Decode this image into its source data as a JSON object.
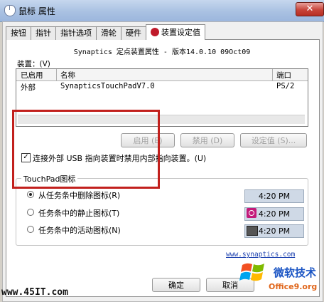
{
  "window": {
    "title": "鼠标 属性",
    "close_glyph": "✕"
  },
  "tabs": [
    {
      "label": "按钮",
      "active": false
    },
    {
      "label": "指针",
      "active": false
    },
    {
      "label": "指针选项",
      "active": false
    },
    {
      "label": "滑轮",
      "active": false
    },
    {
      "label": "硬件",
      "active": false
    },
    {
      "label": "装置设定值",
      "active": true,
      "icon": "synaptics-icon"
    }
  ],
  "panel": {
    "heading": "Synaptics 定点装置属性 - 版本14.0.10 09Oct09",
    "devices_label": "装置：(V)",
    "columns": {
      "enabled": "已启用",
      "name": "名称",
      "port": "端口"
    },
    "rows": [
      {
        "enabled": "外部",
        "name": "SynapticsTouchPadV7.0",
        "port": "PS/2"
      }
    ],
    "buttons": {
      "enable": "启用 (E)",
      "disable": "禁用 (D)",
      "settings": "设定值 (S)..."
    },
    "checkbox": {
      "checked": true,
      "mark": "✓",
      "label": "连接外部 USB 指向装置时禁用内部指向装置。(U)"
    },
    "touchpad_group": {
      "title": "TouchPad图标",
      "options": [
        {
          "label": "从任务条中删除图标(R)",
          "selected": true,
          "preview_time": "4:20 PM",
          "preview_icon": ""
        },
        {
          "label": "任务条中的静止图标(T)",
          "selected": false,
          "preview_time": "4:20 PM",
          "preview_icon": "touchpad-tray-icon"
        },
        {
          "label": "任务条中的活动图标(N)",
          "selected": false,
          "preview_time": "4:20 PM",
          "preview_icon": "monitor-tray-icon"
        }
      ]
    },
    "link": "www.synaptics.com"
  },
  "dialog_buttons": {
    "ok": "确定",
    "cancel": "取消"
  },
  "watermarks": {
    "left": "www.45IT.com",
    "right_main": "微软技术",
    "right_sub": "Office9.org"
  },
  "colors": {
    "highlight_box": "#c2201d",
    "accent_red": "#c01a2a",
    "link": "#1a3fae"
  }
}
